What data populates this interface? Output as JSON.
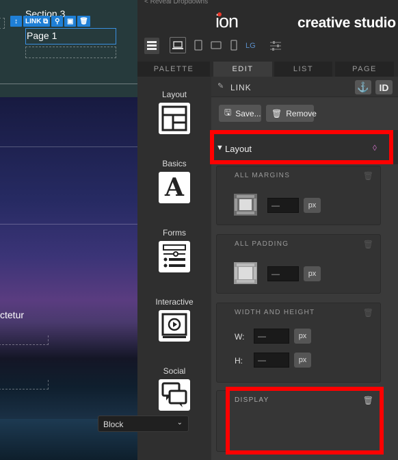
{
  "canvas": {
    "section_label": "Section 3",
    "page_label": "Page 1",
    "body_text": "ctetur",
    "toolbar": {
      "link_label": "LINK"
    }
  },
  "app": {
    "reveal_label": "< Reveal Dropdowns",
    "logo_text": "ion",
    "brand": "creative studio",
    "devices": {
      "lg_label": "LG"
    },
    "tabs": [
      "PALETTE",
      "EDIT",
      "LIST",
      "PAGE"
    ],
    "active_tab": "EDIT",
    "palette": [
      {
        "label": "Layout",
        "icon": "layout-icon"
      },
      {
        "label": "Basics",
        "icon": "letter-a-icon"
      },
      {
        "label": "Forms",
        "icon": "form-icon"
      },
      {
        "label": "Interactive",
        "icon": "play-icon"
      },
      {
        "label": "Social",
        "icon": "chat-bubbles-icon"
      }
    ],
    "editor": {
      "element_title": "LINK",
      "id_label": "ID",
      "save_label": "Save...",
      "remove_label": "Remove",
      "section_title": "Layout",
      "margins": {
        "title": "ALL MARGINS",
        "value": "—",
        "unit": "px"
      },
      "padding": {
        "title": "ALL PADDING",
        "value": "—",
        "unit": "px"
      },
      "size": {
        "title": "WIDTH AND HEIGHT",
        "w_label": "W:",
        "w_value": "—",
        "w_unit": "px",
        "h_label": "H:",
        "h_value": "—",
        "h_unit": "px"
      },
      "display": {
        "title": "DISPLAY",
        "value": "Block"
      }
    },
    "colors": {
      "highlight": "#ff0000",
      "accent": "#1f7fd6",
      "logo_dot": "#e8382a"
    }
  }
}
